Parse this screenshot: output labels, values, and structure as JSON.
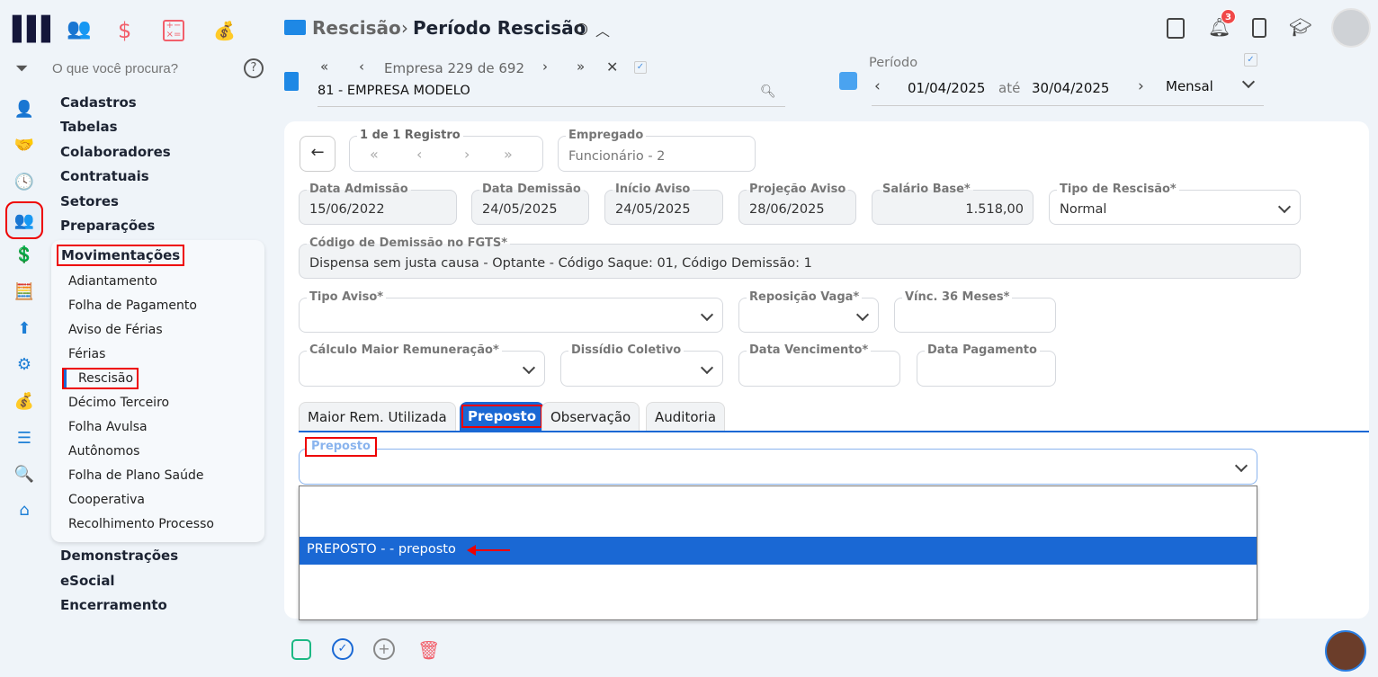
{
  "sidebar": {
    "search_placeholder": "O que você procura?",
    "modules": [
      "people-icon",
      "dollar-icon",
      "calculator-icon",
      "money-bag-icon"
    ],
    "menu": [
      "Cadastros",
      "Tabelas",
      "Colaboradores",
      "Contratuais",
      "Setores",
      "Preparações"
    ],
    "active_group": "Movimentações",
    "submenu": [
      "Adiantamento",
      "Folha de Pagamento",
      "Aviso de Férias",
      "Férias",
      "Rescisão",
      "Décimo Terceiro",
      "Folha Avulsa",
      "Autônomos",
      "Folha de Plano Saúde",
      "Cooperativa",
      "Recolhimento Processo"
    ],
    "menu_after": [
      "Demonstrações",
      "eSocial",
      "Encerramento"
    ]
  },
  "header": {
    "breadcrumb_parent": "Rescisão",
    "sep": "›",
    "title": "Período Rescisão",
    "notification_count": "3",
    "empresa_nav": "Empresa 229 de 692",
    "empresa_value": "81 - EMPRESA MODELO",
    "periodo_label": "Período",
    "date_from": "01/04/2025",
    "ate": "até",
    "date_to": "30/04/2025",
    "periodicity": "Mensal"
  },
  "form": {
    "registro_label": "1 de 1 Registro",
    "empregado": {
      "label": "Empregado",
      "value": "Funcionário - 2"
    },
    "data_admissao": {
      "label": "Data Admissão",
      "value": "15/06/2022"
    },
    "data_demissao": {
      "label": "Data Demissão",
      "value": "24/05/2025"
    },
    "inicio_aviso": {
      "label": "Início Aviso",
      "value": "24/05/2025"
    },
    "projecao_aviso": {
      "label": "Projeção Aviso",
      "value": "28/06/2025"
    },
    "salario_base": {
      "label": "Salário Base*",
      "value": "1.518,00"
    },
    "tipo_rescisao": {
      "label": "Tipo de Rescisão*",
      "value": "Normal"
    },
    "codigo_fgts": {
      "label": "Código de Demissão no FGTS*",
      "value": "Dispensa sem justa causa - Optante - Código Saque: 01, Código Demissão: 1"
    },
    "tipo_aviso": {
      "label": "Tipo Aviso*"
    },
    "reposicao_vaga": {
      "label": "Reposição Vaga*"
    },
    "vinc_36": {
      "label": "Vínc. 36 Meses*"
    },
    "calculo_maior": {
      "label": "Cálculo Maior Remuneração*"
    },
    "dissidio": {
      "label": "Dissídio Coletivo"
    },
    "data_vencimento": {
      "label": "Data Vencimento*"
    },
    "data_pagamento": {
      "label": "Data Pagamento"
    }
  },
  "tabs": [
    "Maior Rem. Utilizada",
    "Preposto",
    "Observação",
    "Auditoria"
  ],
  "preposto": {
    "label": "Preposto",
    "options": [
      "",
      "PREPOSTO - - preposto",
      ""
    ]
  },
  "colors": {
    "accent": "#1a68d4",
    "danger": "#f25f6b",
    "save": "#1cb884"
  }
}
